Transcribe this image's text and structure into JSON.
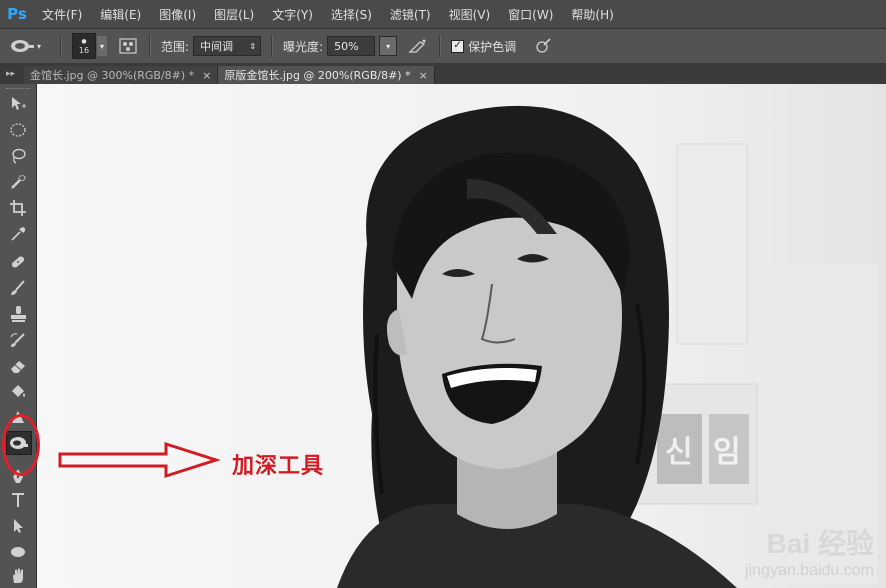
{
  "app": {
    "logo": "Ps"
  },
  "menu": [
    "文件(F)",
    "编辑(E)",
    "图像(I)",
    "图层(L)",
    "文字(Y)",
    "选择(S)",
    "滤镜(T)",
    "视图(V)",
    "窗口(W)",
    "帮助(H)"
  ],
  "options": {
    "brush_size": "16",
    "range_label": "范围:",
    "range_value": "中间调",
    "exposure_label": "曝光度:",
    "exposure_value": "50%",
    "protect_tones_label": "保护色调",
    "protect_tones_checked": true
  },
  "tabs": [
    {
      "title": "金馆长.jpg @ 300%(RGB/8#) *",
      "active": false,
      "close": "×"
    },
    {
      "title": "原版金馆长.jpg @ 200%(RGB/8#) *",
      "active": true,
      "close": "×"
    }
  ],
  "tools": [
    "move-tool",
    "elliptical-marquee-tool",
    "lasso-tool",
    "quick-selection-tool",
    "crop-tool",
    "eyedropper-tool",
    "spot-healing-brush-tool",
    "brush-tool",
    "clone-stamp-tool",
    "history-brush-tool",
    "eraser-tool",
    "paint-bucket-tool",
    "blur-tool",
    "burn-tool",
    "pen-tool",
    "type-tool",
    "path-selection-tool",
    "ellipse-tool",
    "hand-tool"
  ],
  "selected_tool": "burn-tool",
  "annotation": {
    "text": "加深工具",
    "color": "#d21c24"
  },
  "watermark": {
    "brand": "Bai  经验",
    "url": "jingyan.baidu.com"
  },
  "colors": {
    "ps_blue": "#31a8ff",
    "highlight_red": "#e0202a"
  }
}
